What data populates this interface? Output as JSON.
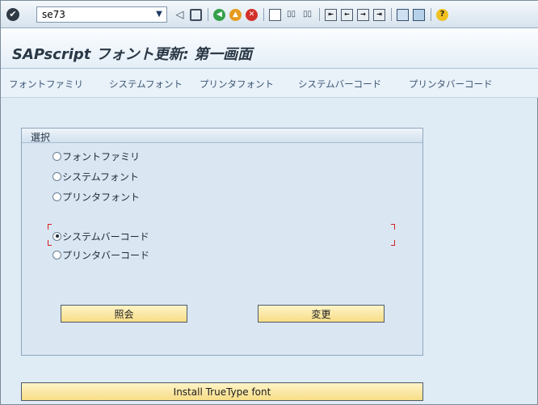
{
  "toolbar": {
    "command_value": "se73",
    "icons": [
      "enter-icon",
      "back-icon",
      "save-icon",
      "back-green-icon",
      "exit-icon",
      "cancel-icon",
      "print-icon",
      "find-icon",
      "find-next-icon",
      "first-page-icon",
      "previous-page-icon",
      "next-page-icon",
      "last-page-icon",
      "create-session-icon",
      "shortcut-icon",
      "help-icon"
    ]
  },
  "title": "SAPscript フォント更新: 第一画面",
  "menu": [
    "フォントファミリ",
    "システムフォント",
    "プリンタフォント",
    "システムバーコード",
    "プリンタバーコード"
  ],
  "selection": {
    "title": "選択",
    "options": [
      {
        "label": "フォントファミリ",
        "selected": false
      },
      {
        "label": "システムフォント",
        "selected": false
      },
      {
        "label": "プリンタフォント",
        "selected": false
      },
      {
        "label": "システムバーコード",
        "selected": true
      },
      {
        "label": "プリンタバーコード",
        "selected": false
      }
    ],
    "display_button": "照会",
    "change_button": "変更"
  },
  "install_button": "Install TrueType font",
  "colors": {
    "background": "#dfebf5",
    "button": "#f7dd86",
    "title": "#2a3846",
    "menu_text": "#3c5673",
    "focus": "#d42020"
  }
}
